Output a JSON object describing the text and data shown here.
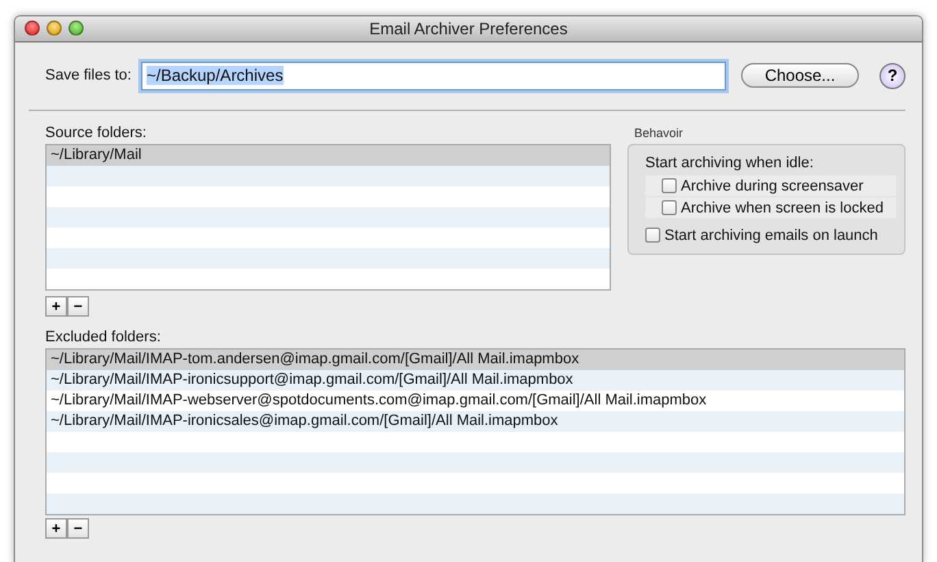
{
  "window": {
    "title": "Email Archiver Preferences"
  },
  "save": {
    "label": "Save files to:",
    "value": "~/Backup/Archives",
    "text_selected": true,
    "choose_button": "Choose...",
    "help_button": "?"
  },
  "source_folders": {
    "label": "Source folders:",
    "rows": [
      {
        "path": "~/Library/Mail",
        "selected": true
      }
    ],
    "add_button": "+",
    "remove_button": "−"
  },
  "behavior": {
    "title": "Behavoir",
    "idle_heading": "Start archiving when idle:",
    "idle_options": [
      {
        "label": "Archive during screensaver",
        "checked": false
      },
      {
        "label": "Archive when screen is locked",
        "checked": false
      }
    ],
    "launch_option": {
      "label": "Start archiving emails on launch",
      "checked": false
    }
  },
  "excluded_folders": {
    "label": "Excluded folders:",
    "rows": [
      {
        "path": "~/Library/Mail/IMAP-tom.andersen@imap.gmail.com/[Gmail]/All Mail.imapmbox",
        "selected": true
      },
      {
        "path": "~/Library/Mail/IMAP-ironicsupport@imap.gmail.com/[Gmail]/All Mail.imapmbox",
        "selected": false
      },
      {
        "path": "~/Library/Mail/IMAP-webserver@spotdocuments.com@imap.gmail.com/[Gmail]/All Mail.imapmbox",
        "selected": false
      },
      {
        "path": "~/Library/Mail/IMAP-ironicsales@imap.gmail.com/[Gmail]/All Mail.imapmbox",
        "selected": false
      }
    ],
    "add_button": "+",
    "remove_button": "−"
  }
}
